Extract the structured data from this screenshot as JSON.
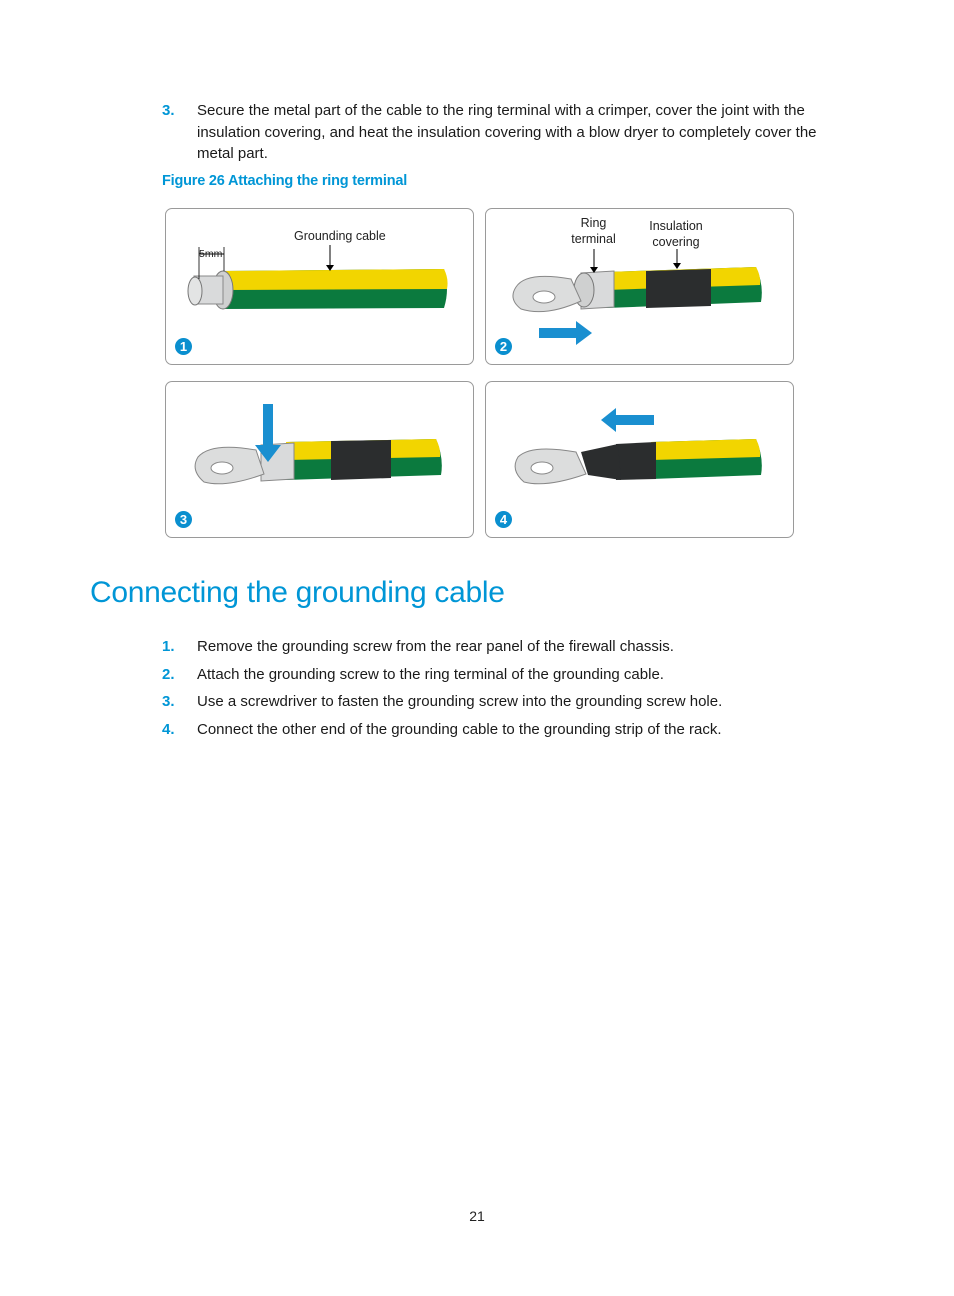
{
  "intro_step": {
    "number": "3.",
    "text": "Secure the metal part of the cable to the ring terminal with a crimper, cover the joint with the insulation covering, and heat the insulation covering with a blow dryer to completely cover the metal part."
  },
  "figure": {
    "caption": "Figure 26 Attaching the ring terminal",
    "panels": [
      {
        "badge": "1",
        "labels": {
          "length": "5mm",
          "cable": "Grounding cable"
        }
      },
      {
        "badge": "2",
        "labels": {
          "terminal": "Ring terminal",
          "insulation": "Insulation covering"
        }
      },
      {
        "badge": "3"
      },
      {
        "badge": "4"
      }
    ],
    "colors": {
      "yellow": "#f2d500",
      "green": "#0b7a3e",
      "black": "#2b2d2e",
      "arrow": "#1a8fd0"
    }
  },
  "section": {
    "heading": "Connecting the grounding cable",
    "steps": [
      {
        "number": "1.",
        "text": "Remove the grounding screw from the rear panel of the firewall chassis."
      },
      {
        "number": "2.",
        "text": "Attach the grounding screw to the ring terminal of the grounding cable."
      },
      {
        "number": "3.",
        "text": "Use a screwdriver to fasten the grounding screw into the grounding screw hole."
      },
      {
        "number": "4.",
        "text": "Connect the other end of the grounding cable to the grounding strip of the rack."
      }
    ]
  },
  "page_number": "21"
}
